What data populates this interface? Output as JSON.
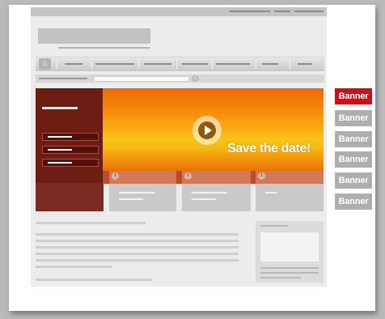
{
  "hero": {
    "headline": "Save the date!",
    "menu_items": 3
  },
  "feature_cards": 3,
  "banners": [
    {
      "label": "Banner",
      "active": true
    },
    {
      "label": "Banner",
      "active": false
    },
    {
      "label": "Banner",
      "active": false
    },
    {
      "label": "Banner",
      "active": false
    },
    {
      "label": "Banner",
      "active": false
    },
    {
      "label": "Banner",
      "active": false
    }
  ],
  "icons": {
    "home": "home-icon",
    "search": "search-icon",
    "play": "play-icon",
    "info": "info-icon"
  },
  "colors": {
    "banner_active": "#c9111e",
    "banner_inactive": "#aeaeae",
    "hero_left": "#6e1d12",
    "hero_gradient_mid": "#f9c41a",
    "hero_band": "#bd4b2a"
  }
}
